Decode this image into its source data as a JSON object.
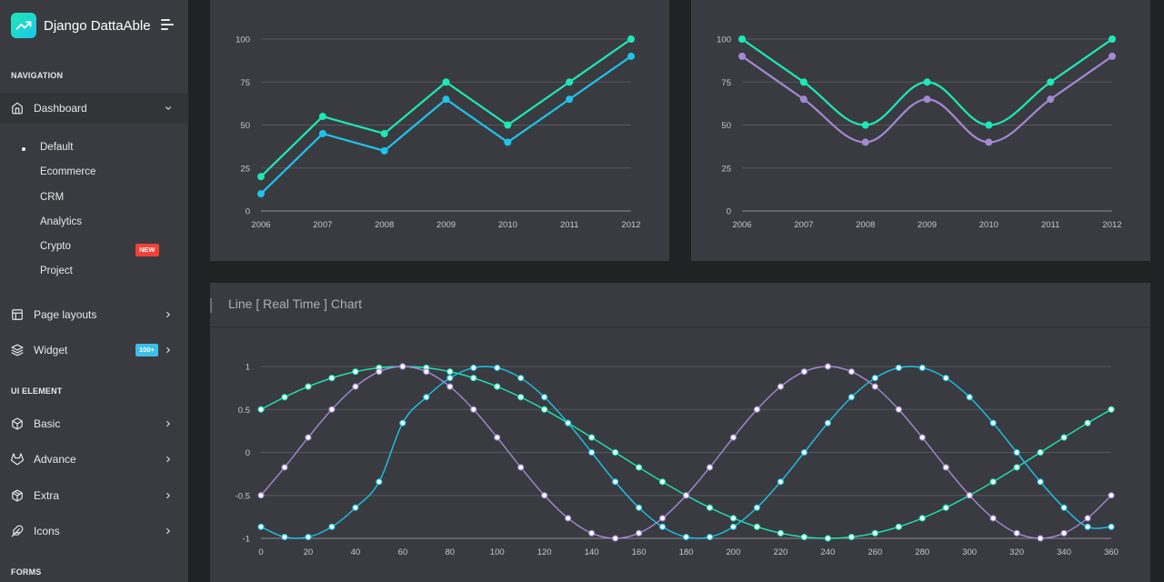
{
  "app": {
    "name": "Django DattaAble"
  },
  "sidebar": {
    "captions": {
      "navigation": "NAVIGATION",
      "ui_element": "UI ELEMENT",
      "forms": "FORMS"
    },
    "dashboard": {
      "label": "Dashboard",
      "children": [
        "Default",
        "Ecommerce",
        "CRM",
        "Analytics",
        "Crypto",
        "Project"
      ],
      "active_child": "Default",
      "crypto_badge": "NEW"
    },
    "items": [
      {
        "label": "Page layouts",
        "icon": "layout-icon"
      },
      {
        "label": "Widget",
        "icon": "layers-icon",
        "badge": "100+"
      },
      {
        "label": "Basic",
        "icon": "box-icon"
      },
      {
        "label": "Advance",
        "icon": "gitlab-icon"
      },
      {
        "label": "Extra",
        "icon": "package-icon"
      },
      {
        "label": "Icons",
        "icon": "feather-icon"
      }
    ]
  },
  "colors": {
    "green": "#1de9b6",
    "blue": "#1dc4e9",
    "purple": "#a389d4",
    "white": "#ffffff"
  },
  "chart_data": [
    {
      "type": "line",
      "x": [
        "2006",
        "2007",
        "2008",
        "2009",
        "2010",
        "2011",
        "2012"
      ],
      "ylim": [
        0,
        100
      ],
      "yticks": [
        "0",
        "25",
        "50",
        "75",
        "100"
      ],
      "grid": true,
      "curve": "straight",
      "series": [
        {
          "color": "#1de9b6",
          "values": [
            20,
            55,
            45,
            75,
            50,
            75,
            100
          ]
        },
        {
          "color": "#1dc4e9",
          "values": [
            10,
            45,
            35,
            65,
            40,
            65,
            90
          ]
        }
      ]
    },
    {
      "type": "line",
      "x": [
        "2006",
        "2007",
        "2008",
        "2009",
        "2010",
        "2011",
        "2012"
      ],
      "ylim": [
        0,
        100
      ],
      "yticks": [
        "0",
        "25",
        "50",
        "75",
        "100"
      ],
      "grid": true,
      "curve": "smooth",
      "series": [
        {
          "color": "#1de9b6",
          "values": [
            100,
            75,
            50,
            75,
            50,
            75,
            100
          ]
        },
        {
          "color": "#a389d4",
          "values": [
            90,
            65,
            40,
            65,
            40,
            65,
            90
          ]
        }
      ]
    },
    {
      "type": "line",
      "title": "Line [ Real Time ] Chart",
      "x": [
        0,
        10,
        20,
        30,
        40,
        50,
        60,
        70,
        80,
        90,
        100,
        110,
        120,
        130,
        140,
        150,
        160,
        170,
        180,
        190,
        200,
        210,
        220,
        230,
        240,
        250,
        260,
        270,
        280,
        290,
        300,
        310,
        320,
        330,
        340,
        350,
        360
      ],
      "xticks": [
        "0",
        "20",
        "40",
        "60",
        "80",
        "100",
        "120",
        "140",
        "160",
        "180",
        "200",
        "220",
        "240",
        "260",
        "280",
        "300",
        "320",
        "340",
        "360"
      ],
      "ylim": [
        -1,
        1
      ],
      "yticks": [
        "-1",
        "-0.5",
        "0",
        "0.5",
        "1"
      ],
      "grid": true,
      "curve": "smooth",
      "series": [
        {
          "color": "#1de9b6",
          "values": [
            0.5,
            0.643,
            0.766,
            0.866,
            0.94,
            0.985,
            1,
            0.985,
            0.94,
            0.866,
            0.766,
            0.643,
            0.5,
            0.342,
            0.174,
            0,
            -0.174,
            -0.342,
            -0.5,
            -0.643,
            -0.766,
            -0.866,
            -0.94,
            -0.985,
            -1,
            -0.985,
            -0.94,
            -0.866,
            -0.766,
            -0.643,
            -0.5,
            -0.342,
            -0.174,
            0,
            0.174,
            0.342,
            0.5
          ]
        },
        {
          "color": "#1dc4e9",
          "values": [
            -0.866,
            -0.985,
            -0.985,
            -0.866,
            -0.643,
            -0.342,
            0.342,
            0.643,
            0.866,
            0.985,
            0.985,
            0.866,
            0.643,
            0.342,
            0,
            -0.342,
            -0.643,
            -0.866,
            -0.985,
            -0.985,
            -0.866,
            -0.643,
            -0.342,
            0,
            0.342,
            0.643,
            0.866,
            0.985,
            0.985,
            0.866,
            0.643,
            0.342,
            0,
            -0.342,
            -0.643,
            -0.866,
            -0.866
          ]
        },
        {
          "color": "#a389d4",
          "values": [
            -0.5,
            -0.174,
            0.174,
            0.5,
            0.766,
            0.94,
            1,
            0.94,
            0.766,
            0.5,
            0.174,
            -0.174,
            -0.5,
            -0.766,
            -0.94,
            -1,
            -0.94,
            -0.766,
            -0.5,
            -0.174,
            0.174,
            0.5,
            0.766,
            0.94,
            1,
            0.94,
            0.766,
            0.5,
            0.174,
            -0.174,
            -0.5,
            -0.766,
            -0.94,
            -1,
            -0.94,
            -0.766,
            -0.5
          ]
        }
      ]
    }
  ]
}
